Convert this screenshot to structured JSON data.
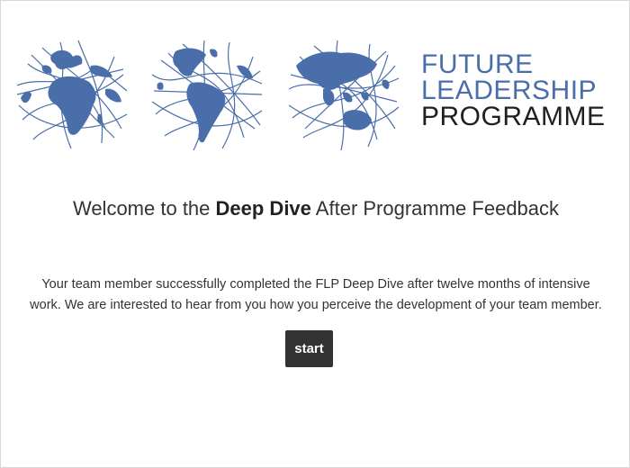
{
  "logo": {
    "line1": "FUTURE",
    "line2": "LEADERSHIP",
    "line3": "PROGRAMME",
    "accent_color": "#4a6ea9",
    "text_dark_color": "#1f1f1f",
    "globes": [
      "globe-africa-europe",
      "globe-americas",
      "globe-asia-australia"
    ]
  },
  "welcome": {
    "prefix": "Welcome to the ",
    "emphasis": "Deep Dive",
    "suffix": " After Programme Feedback"
  },
  "intro": {
    "line1": "Your team member successfully  completed the FLP Deep Dive after twelve months of intensive",
    "line2": "work. We are interested to hear from you how you perceive the development of your team member."
  },
  "start_button": {
    "label": "start",
    "color": "#333333"
  }
}
